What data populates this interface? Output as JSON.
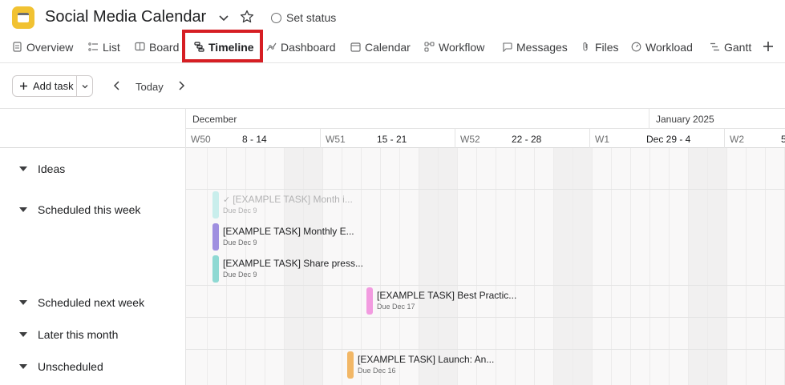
{
  "project": {
    "title": "Social Media Calendar",
    "set_status": "Set status",
    "icon": "calendar-icon",
    "icon_color": "#f1c232"
  },
  "tabs": [
    {
      "label": "Overview",
      "icon": "document-icon"
    },
    {
      "label": "List",
      "icon": "list-icon"
    },
    {
      "label": "Board",
      "icon": "board-icon"
    },
    {
      "label": "Timeline",
      "icon": "timeline-icon",
      "active": true
    },
    {
      "label": "Dashboard",
      "icon": "dashboard-icon"
    },
    {
      "label": "Calendar",
      "icon": "calendar-icon"
    },
    {
      "label": "Workflow",
      "icon": "workflow-icon"
    },
    {
      "label": "Messages",
      "icon": "message-icon"
    },
    {
      "label": "Files",
      "icon": "paperclip-icon"
    },
    {
      "label": "Workload",
      "icon": "workload-icon"
    },
    {
      "label": "Gantt",
      "icon": "gantt-icon"
    }
  ],
  "highlight_color": "#d61e23",
  "toolbar": {
    "add_task": "Add task",
    "today": "Today"
  },
  "calendar": {
    "months": [
      "December",
      "January 2025"
    ],
    "weeks": [
      {
        "num": "W50",
        "range": "8 - 14"
      },
      {
        "num": "W51",
        "range": "15 - 21"
      },
      {
        "num": "W52",
        "range": "22 - 28"
      },
      {
        "num": "W1",
        "range": "Dec 29 - 4"
      },
      {
        "num": "W2",
        "range": "5"
      }
    ]
  },
  "sections": [
    {
      "label": "Ideas"
    },
    {
      "label": "Scheduled this week"
    },
    {
      "label": "Scheduled next week"
    },
    {
      "label": "Later this month"
    },
    {
      "label": "Unscheduled"
    }
  ],
  "tasks": [
    {
      "name": "[EXAMPLE TASK] Month i...",
      "due": "Due Dec 9",
      "color": "#c9eeec",
      "completed": true
    },
    {
      "name": "[EXAMPLE TASK] Monthly E...",
      "due": "Due Dec 9",
      "color": "#9f8fe0",
      "completed": false
    },
    {
      "name": "[EXAMPLE TASK] Share press...",
      "due": "Due Dec 9",
      "color": "#8fd9d3",
      "completed": false
    },
    {
      "name": "[EXAMPLE TASK] Best Practic...",
      "due": "Due Dec 17",
      "color": "#f29be0",
      "completed": false
    },
    {
      "name": "[EXAMPLE TASK] Launch: An...",
      "due": "Due Dec 16",
      "color": "#f2b766",
      "completed": false
    }
  ]
}
